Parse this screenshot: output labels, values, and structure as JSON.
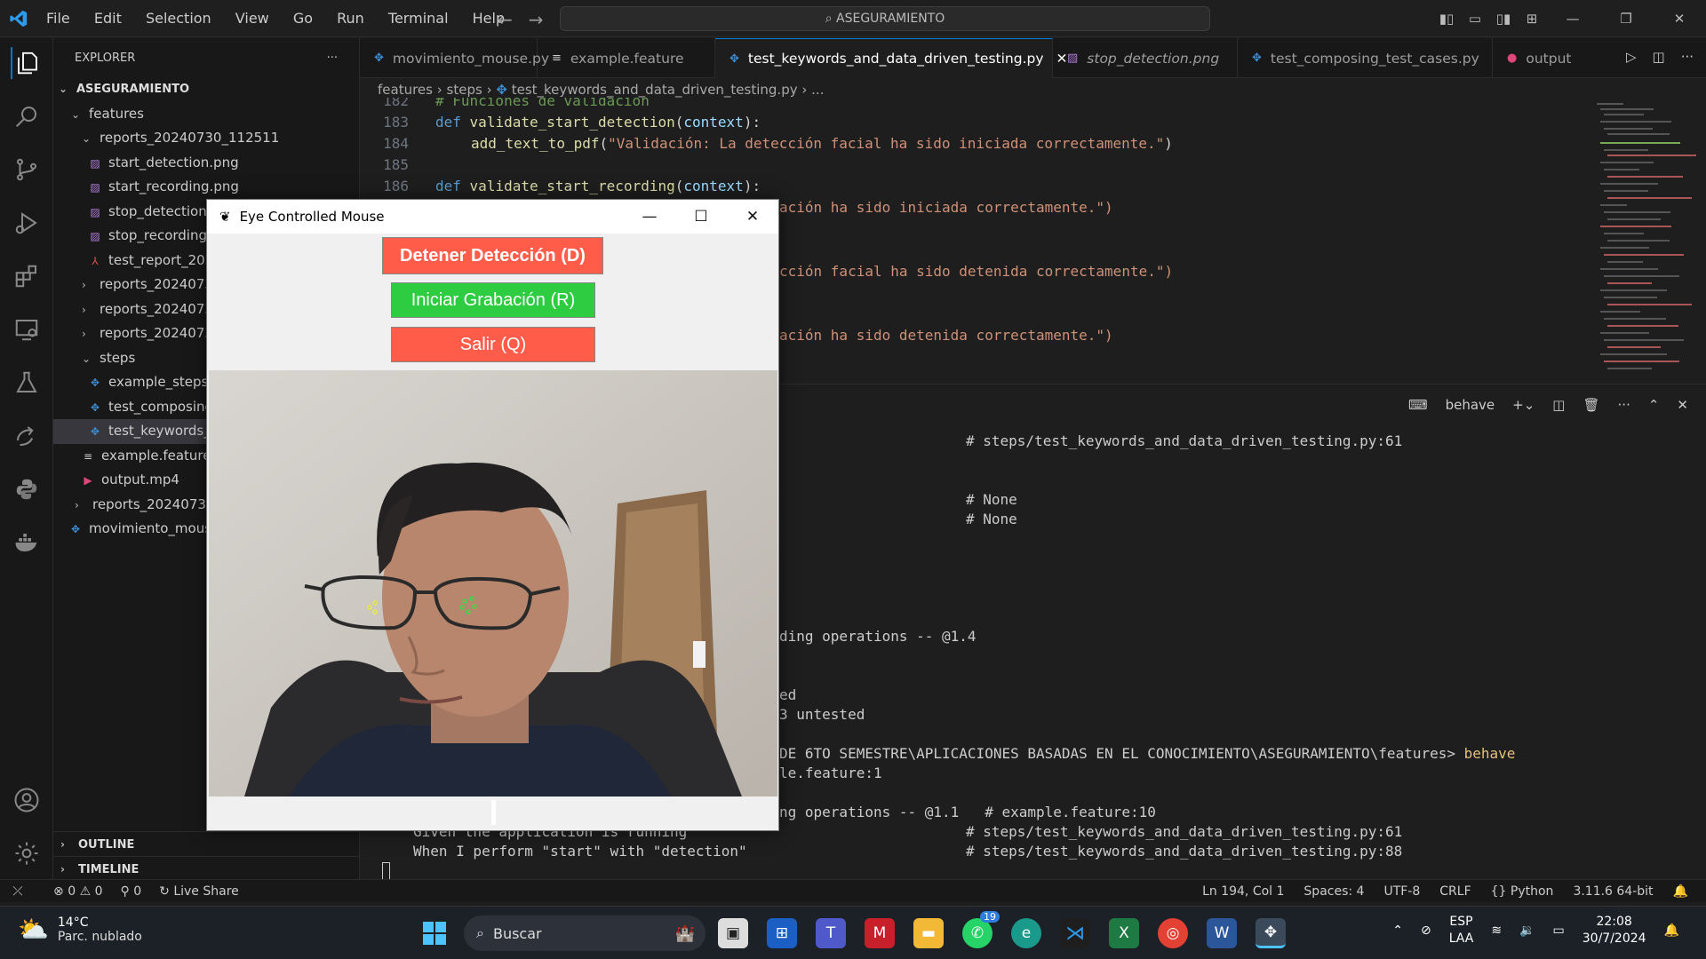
{
  "menu": {
    "file": "File",
    "edit": "Edit",
    "selection": "Selection",
    "view": "View",
    "go": "Go",
    "run": "Run",
    "terminal": "Terminal",
    "help": "Help"
  },
  "command_center": "ASEGURAMIENTO",
  "explorer": {
    "title": "EXPLORER",
    "more": "···",
    "root": "ASEGURAMIENTO",
    "items": [
      {
        "label": "features"
      },
      {
        "label": "reports_20240730_112511"
      },
      {
        "label": "start_detection.png"
      },
      {
        "label": "start_recording.png"
      },
      {
        "label": "stop_detection.png"
      },
      {
        "label": "stop_recording.png"
      },
      {
        "label": "test_report_2024"
      },
      {
        "label": "reports_20240730"
      },
      {
        "label": "reports_20240730"
      },
      {
        "label": "reports_20240730"
      },
      {
        "label": "steps"
      },
      {
        "label": "example_steps.py"
      },
      {
        "label": "test_composing"
      },
      {
        "label": "test_keywords_a"
      },
      {
        "label": "example.feature"
      },
      {
        "label": "output.mp4"
      },
      {
        "label": "reports_20240730_"
      },
      {
        "label": "movimiento_mouse"
      }
    ],
    "outline": "OUTLINE",
    "timeline": "TIMELINE"
  },
  "tabs": [
    {
      "label": "movimiento_mouse.py",
      "icon": "python-icon"
    },
    {
      "label": "example.feature",
      "icon": "lines-icon"
    },
    {
      "label": "test_keywords_and_data_driven_testing.py",
      "icon": "python-icon",
      "close": "✕"
    },
    {
      "label": "stop_detection.png",
      "icon": "image-icon"
    },
    {
      "label": "test_composing_test_cases.py",
      "icon": "python-icon"
    },
    {
      "label": "output",
      "icon": "record-icon"
    }
  ],
  "breadcrumb": {
    "a": "features",
    "b": "steps",
    "c": "test_keywords_and_data_driven_testing.py",
    "d": "..."
  },
  "editor": {
    "comment": "# Funciones de validación",
    "lines": [
      "182",
      "183",
      "184",
      "185",
      "186"
    ],
    "def1_kw": "def",
    "def1_name": "validate_start_detection",
    "def1_param": "context",
    "call1_fn": "add_text_to_pdf",
    "call1_str": "\"Validación: La detección facial ha sido iniciada correctamente.\"",
    "def2_kw": "def",
    "def2_name": "validate_start_recording",
    "def2_param": "context",
    "frag1": "ación ha sido iniciada correctamente.\")",
    "frag2": "cción facial ha sido detenida correctamente.\")",
    "frag3": "ación ha sido detenida correctamente.\")"
  },
  "panel": {
    "terminal_name": "behave"
  },
  "terminal": {
    "l1": "# steps/test_keywords_and_data_driven_testing.py:61",
    "l2": "# None",
    "l3": "# None",
    "l4": "ding operations -- @1.4",
    "l5": "ed",
    "l6": "3 untested",
    "l7a": "DE 6TO SEMESTRE\\APLICACIONES BASADAS EN EL CONOCIMIENTO\\ASEGURAMIENTO\\features>",
    "l7b": " behave",
    "l8": "le.feature:1",
    "l9": "ng operations -- @1.1   # example.feature:10",
    "l10a": "Given the application is running",
    "l10b": "# steps/test_keywords_and_data_driven_testing.py:61",
    "l11a": "When I perform \"start\" with \"detection\"",
    "l11b": "# steps/test_keywords_and_data_driven_testing.py:88"
  },
  "statusbar": {
    "errors": "0",
    "warnings": "0",
    "ports": "0",
    "liveshare": "Live Share",
    "position": "Ln 194, Col 1",
    "spaces": "Spaces: 4",
    "encoding": "UTF-8",
    "eol": "CRLF",
    "language": "Python",
    "interpreter": "3.11.6 64-bit"
  },
  "app_window": {
    "title": "Eye Controlled Mouse",
    "btn_stop_detection": "Detener Detección (D)",
    "btn_start_recording": "Iniciar Grabación (R)",
    "btn_exit": "Salir (Q)"
  },
  "taskbar": {
    "temp": "14°C",
    "weather": "Parc. nublado",
    "search": "Buscar",
    "whatsapp_badge": "19",
    "lang1": "ESP",
    "lang2": "LAA",
    "time": "22:08",
    "date": "30/7/2024"
  },
  "colors": {
    "accent": "#0078d4",
    "red_button": "#ff5c4a",
    "green_button": "#2ecc40"
  }
}
